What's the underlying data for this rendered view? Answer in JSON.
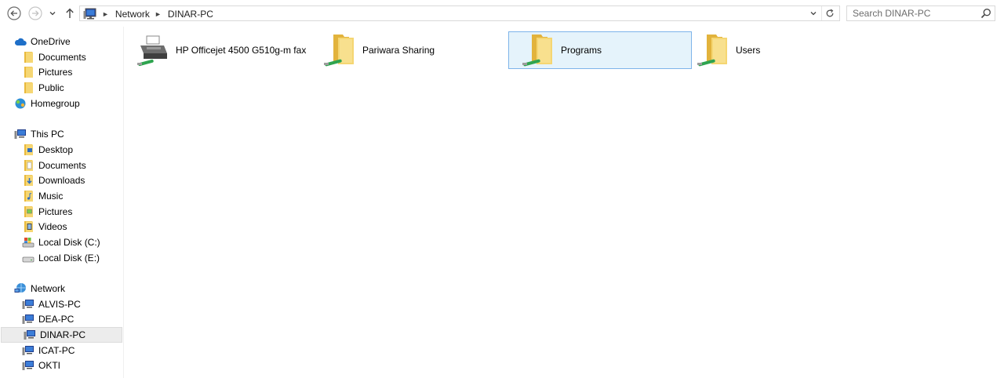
{
  "toolbar": {
    "back_label": "Back",
    "forward_label": "Forward",
    "recent_label": "Recent locations",
    "up_label": "Up"
  },
  "address": {
    "crumbs": [
      "Network",
      "DINAR-PC"
    ]
  },
  "search": {
    "placeholder": "Search DINAR-PC"
  },
  "navpane": {
    "items": [
      {
        "label": "OneDrive",
        "icon": "cloud-icon"
      },
      {
        "label": "Documents",
        "icon": "folder-icon"
      },
      {
        "label": "Pictures",
        "icon": "folder-icon"
      },
      {
        "label": "Public",
        "icon": "folder-icon"
      },
      {
        "label": "Homegroup",
        "icon": "homegroup-icon"
      },
      {
        "label": "This PC",
        "icon": "computer-icon"
      },
      {
        "label": "Desktop",
        "icon": "desktop-folder-icon"
      },
      {
        "label": "Documents",
        "icon": "documents-folder-icon"
      },
      {
        "label": "Downloads",
        "icon": "downloads-folder-icon"
      },
      {
        "label": "Music",
        "icon": "music-folder-icon"
      },
      {
        "label": "Pictures",
        "icon": "pictures-folder-icon"
      },
      {
        "label": "Videos",
        "icon": "videos-folder-icon"
      },
      {
        "label": "Local Disk (C:)",
        "icon": "system-drive-icon"
      },
      {
        "label": "Local Disk (E:)",
        "icon": "drive-icon"
      },
      {
        "label": "Network",
        "icon": "network-icon"
      },
      {
        "label": "ALVIS-PC",
        "icon": "computer-icon"
      },
      {
        "label": "DEA-PC",
        "icon": "computer-icon"
      },
      {
        "label": "DINAR-PC",
        "icon": "computer-icon",
        "selected": true
      },
      {
        "label": "ICAT-PC",
        "icon": "computer-icon"
      },
      {
        "label": "OKTI",
        "icon": "computer-icon"
      }
    ]
  },
  "content": {
    "items": [
      {
        "label": "HP Officejet 4500 G510g-m fax",
        "icon": "network-printer-icon"
      },
      {
        "label": "Pariwara Sharing",
        "icon": "shared-folder-icon"
      },
      {
        "label": "Programs",
        "icon": "shared-folder-icon",
        "selected": true
      },
      {
        "label": "Users",
        "icon": "shared-folder-icon"
      }
    ]
  },
  "colors": {
    "selection_fill": "#e5f3fb",
    "selection_border": "#7eb4ea",
    "folder_yellow": "#f3cf5e",
    "share_green": "#2ea44f"
  }
}
